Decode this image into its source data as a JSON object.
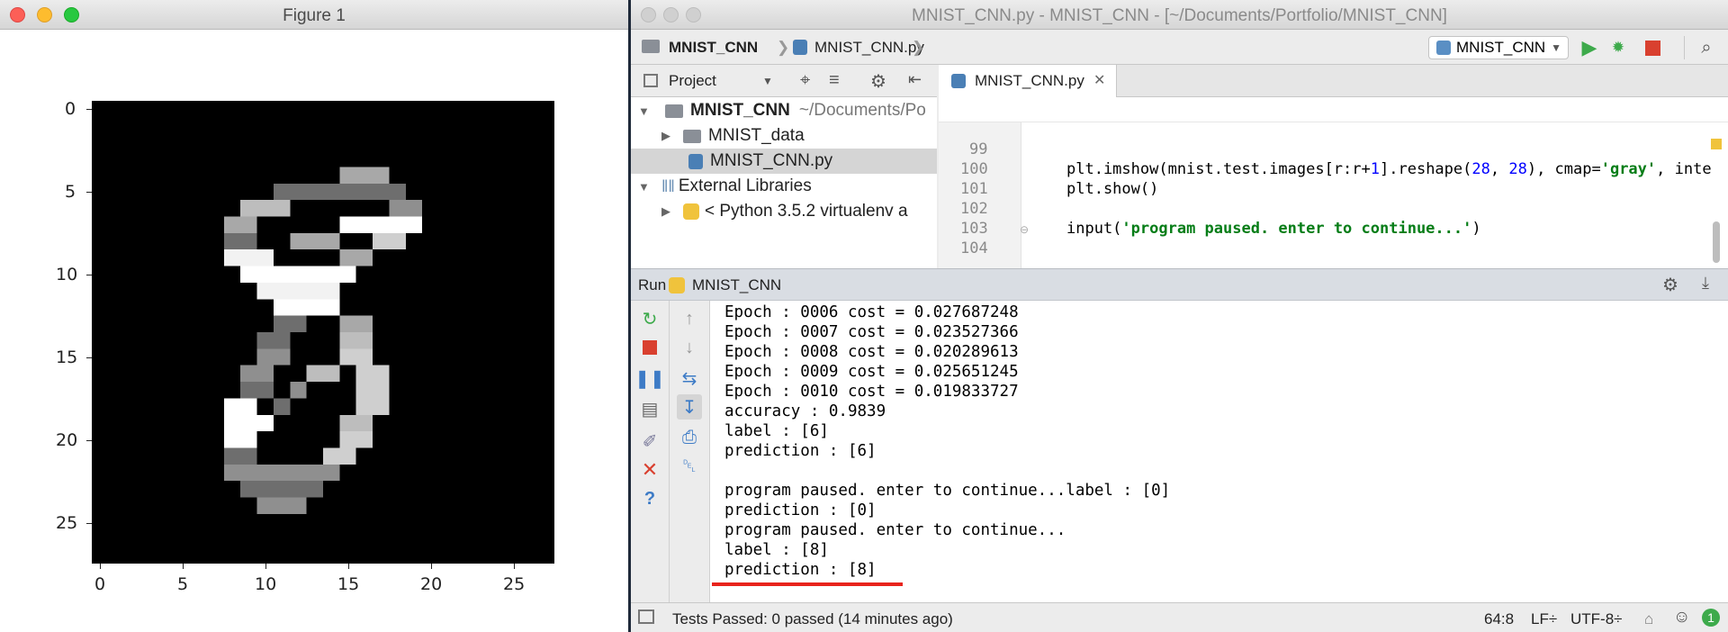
{
  "figure": {
    "title": "Figure 1",
    "x_ticks": [
      "0",
      "5",
      "10",
      "15",
      "20",
      "25"
    ],
    "y_ticks": [
      "0",
      "5",
      "10",
      "15",
      "20",
      "25"
    ],
    "image_grid_size": 28
  },
  "ide": {
    "title": "MNIST_CNN.py - MNIST_CNN - [~/Documents/Portfolio/MNIST_CNN]",
    "breadcrumb": {
      "project": "MNIST_CNN",
      "file": "MNIST_CNN.py"
    },
    "run_config": "MNIST_CNN",
    "project_panel_label": "Project",
    "editor_tab": "MNIST_CNN.py",
    "tree": {
      "root_name": "MNIST_CNN",
      "root_path": "~/Documents/Po",
      "folder": "MNIST_data",
      "file": "MNIST_CNN.py",
      "external": "External Libraries",
      "python": "< Python 3.5.2 virtualenv a"
    },
    "code_lines": [
      {
        "num": "99",
        "text": ""
      },
      {
        "num": "100",
        "text": "plt.imshow(mnist.test.images[r:r+1].reshape(28, 28), cmap='gray', inte"
      },
      {
        "num": "101",
        "text": "plt.show()"
      },
      {
        "num": "102",
        "text": ""
      },
      {
        "num": "103",
        "text": "input('program paused. enter to continue...')"
      },
      {
        "num": "104",
        "text": ""
      }
    ],
    "run_label": "Run",
    "run_name": "MNIST_CNN",
    "console_lines": [
      "Epoch : 0006 cost = 0.027687248",
      "Epoch : 0007 cost = 0.023527366",
      "Epoch : 0008 cost = 0.020289613",
      "Epoch : 0009 cost = 0.025651245",
      "Epoch : 0010 cost = 0.019833727",
      "accuracy : 0.9839",
      "label : [6]",
      "prediction : [6]",
      "",
      "program paused. enter to continue...label : [0]",
      "prediction : [0]",
      "program paused. enter to continue...",
      "label : [8]",
      "prediction : [8]"
    ],
    "status": {
      "tests": "Tests Passed: 0 passed (14 minutes ago)",
      "position": "64:8",
      "line_sep": "LF÷",
      "encoding": "UTF-8÷",
      "badge": "1"
    }
  },
  "colors": {
    "underline": "#e8231c",
    "run_green": "#3daa4b",
    "stop_red": "#d9402f"
  }
}
